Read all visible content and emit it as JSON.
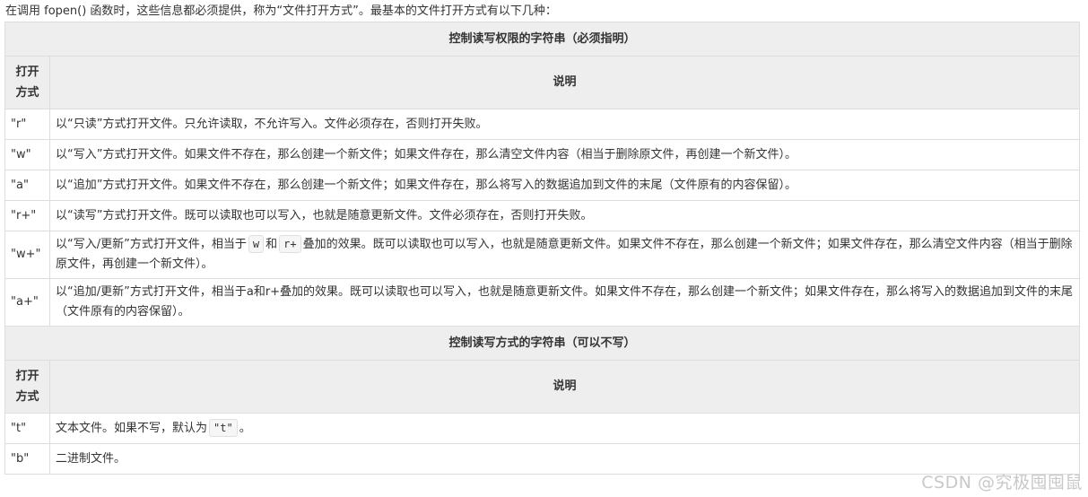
{
  "intro": "在调用 fopen() 函数时，这些信息都必须提供，称为“文件打开方式”。最基本的文件打开方式有以下几种：",
  "section1": {
    "title": "控制读写权限的字符串（必须指明）",
    "col_mode": "打开方式",
    "col_desc": "说明",
    "rows": [
      {
        "mode": "\"r\"",
        "desc": "以“只读”方式打开文件。只允许读取，不允许写入。文件必须存在，否则打开失败。"
      },
      {
        "mode": "\"w\"",
        "desc": "以“写入”方式打开文件。如果文件不存在，那么创建一个新文件；如果文件存在，那么清空文件内容（相当于删除原文件，再创建一个新文件）。"
      },
      {
        "mode": "\"a\"",
        "desc": "以“追加”方式打开文件。如果文件不存在，那么创建一个新文件；如果文件存在，那么将写入的数据追加到文件的末尾（文件原有的内容保留）。"
      },
      {
        "mode": "\"r+\"",
        "desc": "以“读写”方式打开文件。既可以读取也可以写入，也就是随意更新文件。文件必须存在，否则打开失败。"
      },
      {
        "mode": "\"w+\"",
        "desc_a": "以“写入/更新”方式打开文件，相当于",
        "code1": "w",
        "desc_b": "和",
        "code2": "r+",
        "desc_c": "叠加的效果。既可以读取也可以写入，也就是随意更新文件。如果文件不存在，那么创建一个新文件；如果文件存在，那么清空文件内容（相当于删除原文件，再创建一个新文件）。"
      },
      {
        "mode": "\"a+\"",
        "desc": "以“追加/更新”方式打开文件，相当于a和r+叠加的效果。既可以读取也可以写入，也就是随意更新文件。如果文件不存在，那么创建一个新文件；如果文件存在，那么将写入的数据追加到文件的末尾（文件原有的内容保留）。"
      }
    ]
  },
  "section2": {
    "title": "控制读写方式的字符串（可以不写）",
    "col_mode": "打开方式",
    "col_desc": "说明",
    "rows": [
      {
        "mode": "\"t\"",
        "desc_a": "文本文件。如果不写，默认为",
        "code1": "\"t\"",
        "desc_b": "。"
      },
      {
        "mode": "\"b\"",
        "desc": "二进制文件。"
      }
    ]
  },
  "watermark": "CSDN @究极囤囤鼠"
}
